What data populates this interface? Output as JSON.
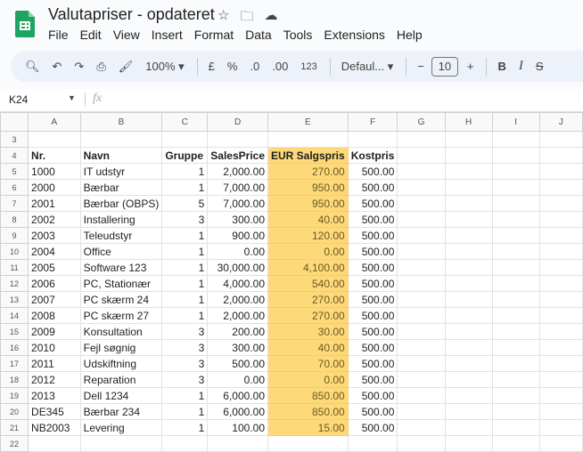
{
  "app": {
    "title": "Valutapriser - opdateret",
    "icons": [
      "star-icon",
      "move-to-folder-icon",
      "cloud-saved-icon"
    ]
  },
  "menu": [
    "File",
    "Edit",
    "View",
    "Insert",
    "Format",
    "Data",
    "Tools",
    "Extensions",
    "Help"
  ],
  "toolbar": {
    "zoom": "100%",
    "currency": "£",
    "percent": "%",
    "dec_decrease": ".0",
    "dec_increase": ".00",
    "format_more": "123",
    "font": "Defaul...",
    "font_size": "10",
    "bold": "B",
    "italic": "I"
  },
  "namebox": {
    "cell": "K24",
    "fx": "fx"
  },
  "columns": [
    "A",
    "B",
    "C",
    "D",
    "E",
    "F",
    "G",
    "H",
    "I",
    "J"
  ],
  "highlight_color": "#fdd97a",
  "header_row": {
    "row": "4",
    "cells": [
      "Nr.",
      "Navn",
      "Gruppe",
      "SalesPrice",
      "EUR Salgspris",
      "Kostpris"
    ]
  },
  "rows": [
    {
      "n": "5",
      "c": [
        "1000",
        "IT udstyr",
        "1",
        "2,000.00",
        "270.00",
        "500.00"
      ]
    },
    {
      "n": "6",
      "c": [
        "2000",
        "Bærbar",
        "1",
        "7,000.00",
        "950.00",
        "500.00"
      ]
    },
    {
      "n": "7",
      "c": [
        "2001",
        "Bærbar (OBPS)",
        "5",
        "7,000.00",
        "950.00",
        "500.00"
      ]
    },
    {
      "n": "8",
      "c": [
        "2002",
        "Installering",
        "3",
        "300.00",
        "40.00",
        "500.00"
      ]
    },
    {
      "n": "9",
      "c": [
        "2003",
        "Teleudstyr",
        "1",
        "900.00",
        "120.00",
        "500.00"
      ]
    },
    {
      "n": "10",
      "c": [
        "2004",
        "Office",
        "1",
        "0.00",
        "0.00",
        "500.00"
      ]
    },
    {
      "n": "11",
      "c": [
        "2005",
        "Software 123",
        "1",
        "30,000.00",
        "4,100.00",
        "500.00"
      ]
    },
    {
      "n": "12",
      "c": [
        "2006",
        "PC, Stationær",
        "1",
        "4,000.00",
        "540.00",
        "500.00"
      ]
    },
    {
      "n": "13",
      "c": [
        "2007",
        "PC skærm 24",
        "1",
        "2,000.00",
        "270.00",
        "500.00"
      ]
    },
    {
      "n": "14",
      "c": [
        "2008",
        "PC skærm 27",
        "1",
        "2,000.00",
        "270.00",
        "500.00"
      ]
    },
    {
      "n": "15",
      "c": [
        "2009",
        "Konsultation",
        "3",
        "200.00",
        "30.00",
        "500.00"
      ]
    },
    {
      "n": "16",
      "c": [
        "2010",
        "Fejl søgnig",
        "3",
        "300.00",
        "40.00",
        "500.00"
      ]
    },
    {
      "n": "17",
      "c": [
        "2011",
        "Udskiftning",
        "3",
        "500.00",
        "70.00",
        "500.00"
      ]
    },
    {
      "n": "18",
      "c": [
        "2012",
        "Reparation",
        "3",
        "0.00",
        "0.00",
        "500.00"
      ]
    },
    {
      "n": "19",
      "c": [
        "2013",
        "Dell 1234",
        "1",
        "6,000.00",
        "850.00",
        "500.00"
      ]
    },
    {
      "n": "20",
      "c": [
        "DE345",
        "Bærbar 234",
        "1",
        "6,000.00",
        "850.00",
        "500.00"
      ]
    },
    {
      "n": "21",
      "c": [
        "NB2003",
        "Levering",
        "1",
        "100.00",
        "15.00",
        "500.00"
      ]
    }
  ],
  "empty_rows": {
    "before": "3",
    "after": "22"
  }
}
